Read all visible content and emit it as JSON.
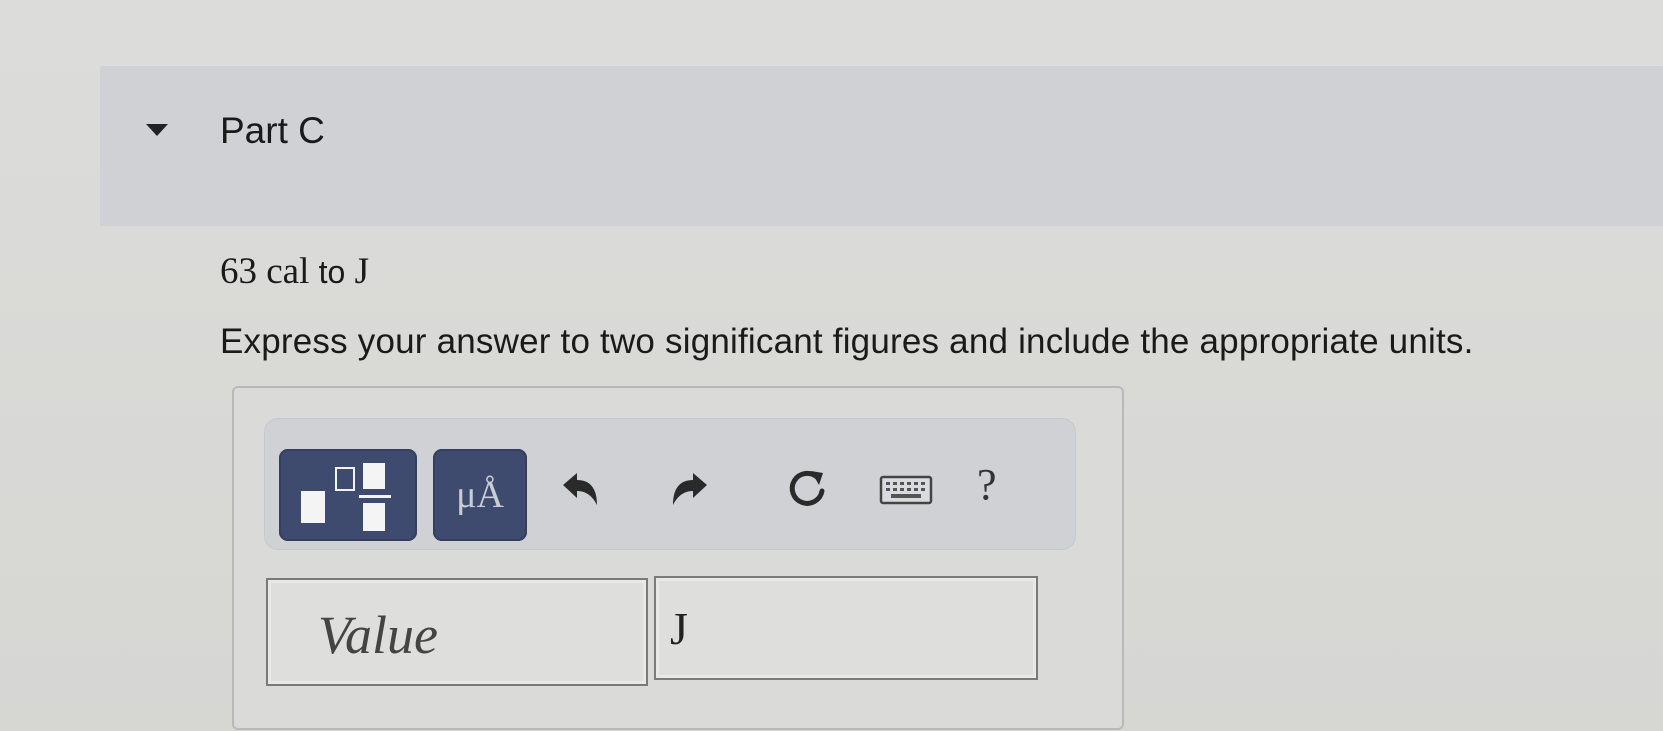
{
  "part": {
    "title": "Part C"
  },
  "question": {
    "number": "63",
    "from_unit": "cal",
    "connector": "to",
    "to_unit": "J"
  },
  "instruction": "Express your answer to two significant figures and include the appropriate units.",
  "toolbar": {
    "units_label": "μÅ",
    "help_label": "?",
    "icons": [
      "templates-icon",
      "units-icon",
      "undo-icon",
      "redo-icon",
      "reset-icon",
      "keyboard-icon",
      "help-icon"
    ]
  },
  "answer": {
    "value_placeholder": "Value",
    "unit_value": "J"
  },
  "colors": {
    "toolbar_button": "#3e4a6e",
    "header_band": "#cfd1d4"
  }
}
